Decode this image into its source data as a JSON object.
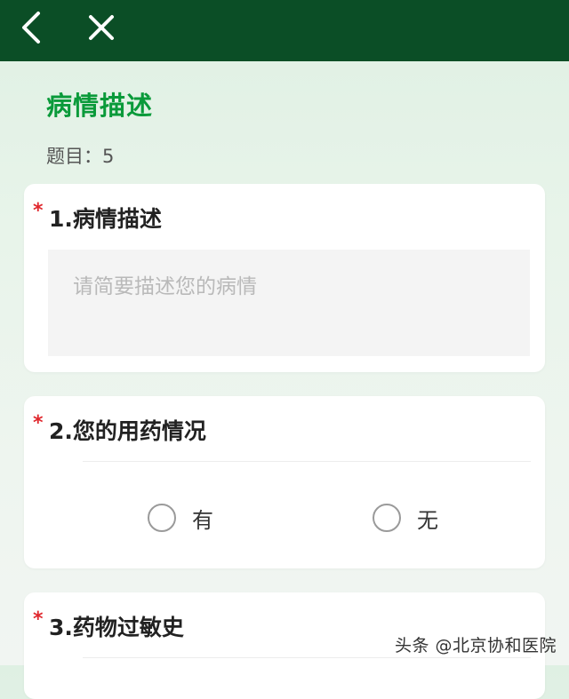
{
  "header": {
    "back_icon": "chevron-left-icon",
    "close_icon": "close-icon",
    "background": "#0b4e26"
  },
  "survey": {
    "title": "病情描述",
    "question_count": "题目：5",
    "title_color": "#0a9a3a"
  },
  "questions": [
    {
      "required_mark": "*",
      "title": "1.病情描述",
      "type": "textarea",
      "placeholder": "请简要描述您的病情",
      "value": ""
    },
    {
      "required_mark": "*",
      "title": "2.您的用药情况",
      "type": "radio",
      "options": [
        "有",
        "无"
      ]
    },
    {
      "required_mark": "*",
      "title": "3.药物过敏史"
    }
  ],
  "watermark": "头条 @北京协和医院",
  "colors": {
    "required": "#e0282e"
  }
}
